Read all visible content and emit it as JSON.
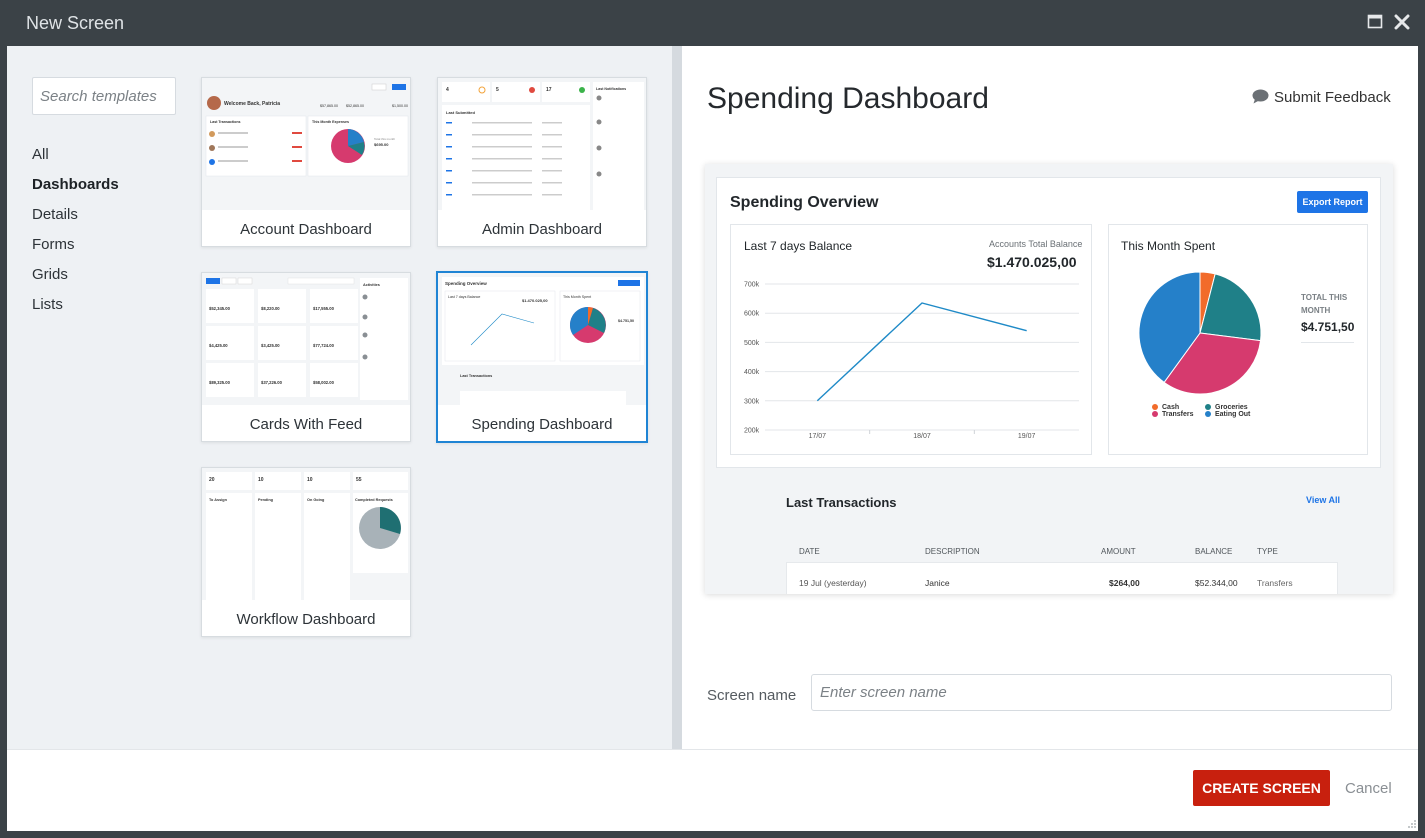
{
  "window": {
    "title": "New Screen"
  },
  "search": {
    "placeholder": "Search templates"
  },
  "categories": [
    "All",
    "Dashboards",
    "Details",
    "Forms",
    "Grids",
    "Lists"
  ],
  "templates": [
    "Account Dashboard",
    "Admin Dashboard",
    "Cards With Feed",
    "Spending Dashboard",
    "Workflow Dashboard"
  ],
  "thumb_account": {
    "welcome": "Welcome Back, Patricia",
    "v1": "$57,865.00",
    "v2": "$52,865.00",
    "v3": "$1,500.00",
    "lt": "Last Transactions",
    "me": "This Month Expenses",
    "total": "$695.00"
  },
  "thumb_admin": {
    "n1": "4",
    "n2": "5",
    "n3": "17",
    "ls": "Last Submitted",
    "ln": "Last Notifications"
  },
  "thumb_feed": {
    "act": "Activities",
    "a1": "$52,345.00",
    "a2": "$8,220.00",
    "a3": "$17,555.00",
    "b1": "$4,425.00",
    "b2": "$3,425.00",
    "b3": "$77,724.00",
    "c1": "$89,325.00",
    "c2": "$37,226.00",
    "c3": "$58,002.00"
  },
  "thumb_spending": {
    "ov": "Spending Overview",
    "bal": "Last 7 days Balance",
    "val": "$1.470.025,00",
    "spent": "This Month Spent",
    "tot": "$4.751,50",
    "lt": "Last Transactions"
  },
  "thumb_workflow": {
    "w1": "20",
    "w2": "10",
    "w3": "10",
    "w4": "55",
    "c1": "To Assign",
    "c2": "Pending",
    "c3": "On Going",
    "c4": "Completed Requests"
  },
  "preview": {
    "title": "Spending Dashboard",
    "feedback": "Submit Feedback",
    "overview_title": "Spending Overview",
    "export": "Export Report",
    "balance_title": "Last 7 days Balance",
    "accounts_label": "Accounts Total Balance",
    "accounts_value": "$1.470.025,00",
    "spent_title": "This Month Spent",
    "total_label_1": "TOTAL THIS",
    "total_label_2": "MONTH",
    "total_value": "$4.751,50",
    "transactions_title": "Last Transactions",
    "view_all": "View All",
    "columns": [
      "DATE",
      "DESCRIPTION",
      "AMOUNT",
      "BALANCE",
      "TYPE"
    ],
    "row": [
      "19 Jul (yesterday)",
      "Janice",
      "$264,00",
      "$52.344,00",
      "Transfers"
    ]
  },
  "chart_data": [
    {
      "type": "line",
      "title": "Last 7 days Balance",
      "x": [
        "17/07",
        "18/07",
        "19/07"
      ],
      "yticks": [
        "200k",
        "300k",
        "400k",
        "500k",
        "600k",
        "700k"
      ],
      "ylim": [
        200000,
        700000
      ],
      "series": [
        {
          "values": [
            300000,
            635000,
            540000
          ]
        }
      ],
      "color": "#1f8ac7"
    },
    {
      "type": "pie",
      "title": "This Month Spent",
      "labels": [
        "Cash",
        "Groceries",
        "Transfers",
        "Eating Out"
      ],
      "values": [
        4,
        23,
        33,
        40
      ],
      "colors": [
        "#f26b2a",
        "#1f8088",
        "#d63a6e",
        "#2580c9"
      ]
    }
  ],
  "form": {
    "screen_name_label": "Screen name",
    "screen_name_placeholder": "Enter screen name"
  },
  "footer": {
    "create": "CREATE SCREEN",
    "cancel": "Cancel"
  }
}
